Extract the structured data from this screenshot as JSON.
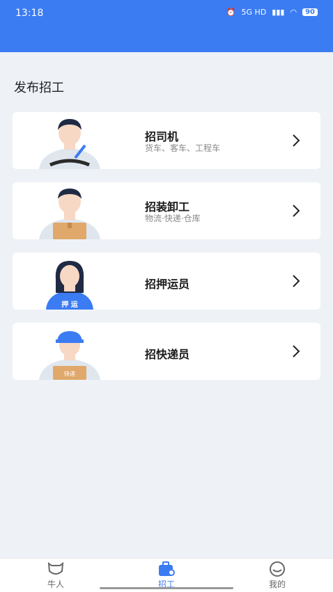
{
  "status": {
    "time": "13:18",
    "battery": "90",
    "network": "5G HD"
  },
  "page": {
    "title": "发布招工"
  },
  "cards": [
    {
      "title": "招司机",
      "subtitle": "货车、客车、工程车"
    },
    {
      "title": "招装卸工",
      "subtitle": "物流·快递·仓库"
    },
    {
      "title": "招押运员",
      "subtitle": "",
      "badge_text": "押 运"
    },
    {
      "title": "招快递员",
      "subtitle": "",
      "badge_text": "快递"
    }
  ],
  "tabbar": {
    "items": [
      {
        "label": "牛人"
      },
      {
        "label": "招工"
      },
      {
        "label": "我的"
      }
    ],
    "active_color": "#3b7cf3"
  }
}
